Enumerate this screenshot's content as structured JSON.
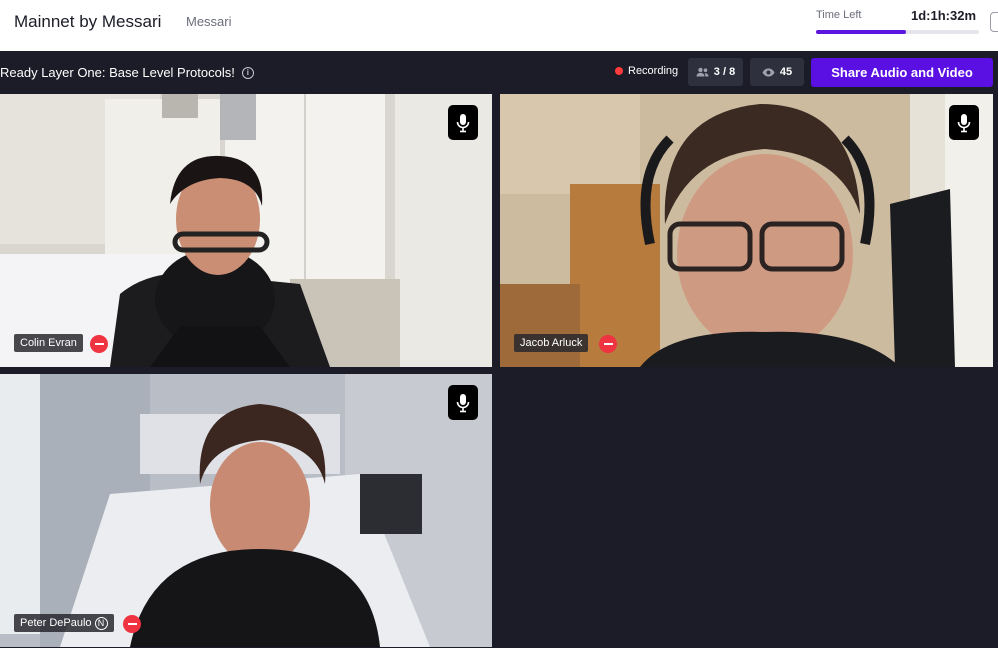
{
  "header": {
    "app_title": "Mainnet by Messari",
    "org_link": "Messari",
    "time_left_label": "Time Left",
    "time_left_value": "1d:1h:32m",
    "time_progress": 0.55
  },
  "toolbar": {
    "room_title": "Ready Layer One: Base Level Protocols!",
    "recording_label": "Recording",
    "participants": "3 / 8",
    "viewers": "45",
    "share_button": "Share Audio and Video"
  },
  "participants": [
    {
      "name": "Colin Evran",
      "badge": ""
    },
    {
      "name": "Jacob Arluck",
      "badge": ""
    },
    {
      "name": "Peter DePaulo",
      "badge": "N"
    }
  ],
  "colors": {
    "accent": "#5b10e3",
    "recording": "#ff3b3b",
    "remove": "#ef3340",
    "background": "#1b1c27"
  },
  "icons": [
    "info-icon",
    "recording-dot-icon",
    "people-icon",
    "eye-icon",
    "microphone-icon",
    "remove-icon"
  ]
}
